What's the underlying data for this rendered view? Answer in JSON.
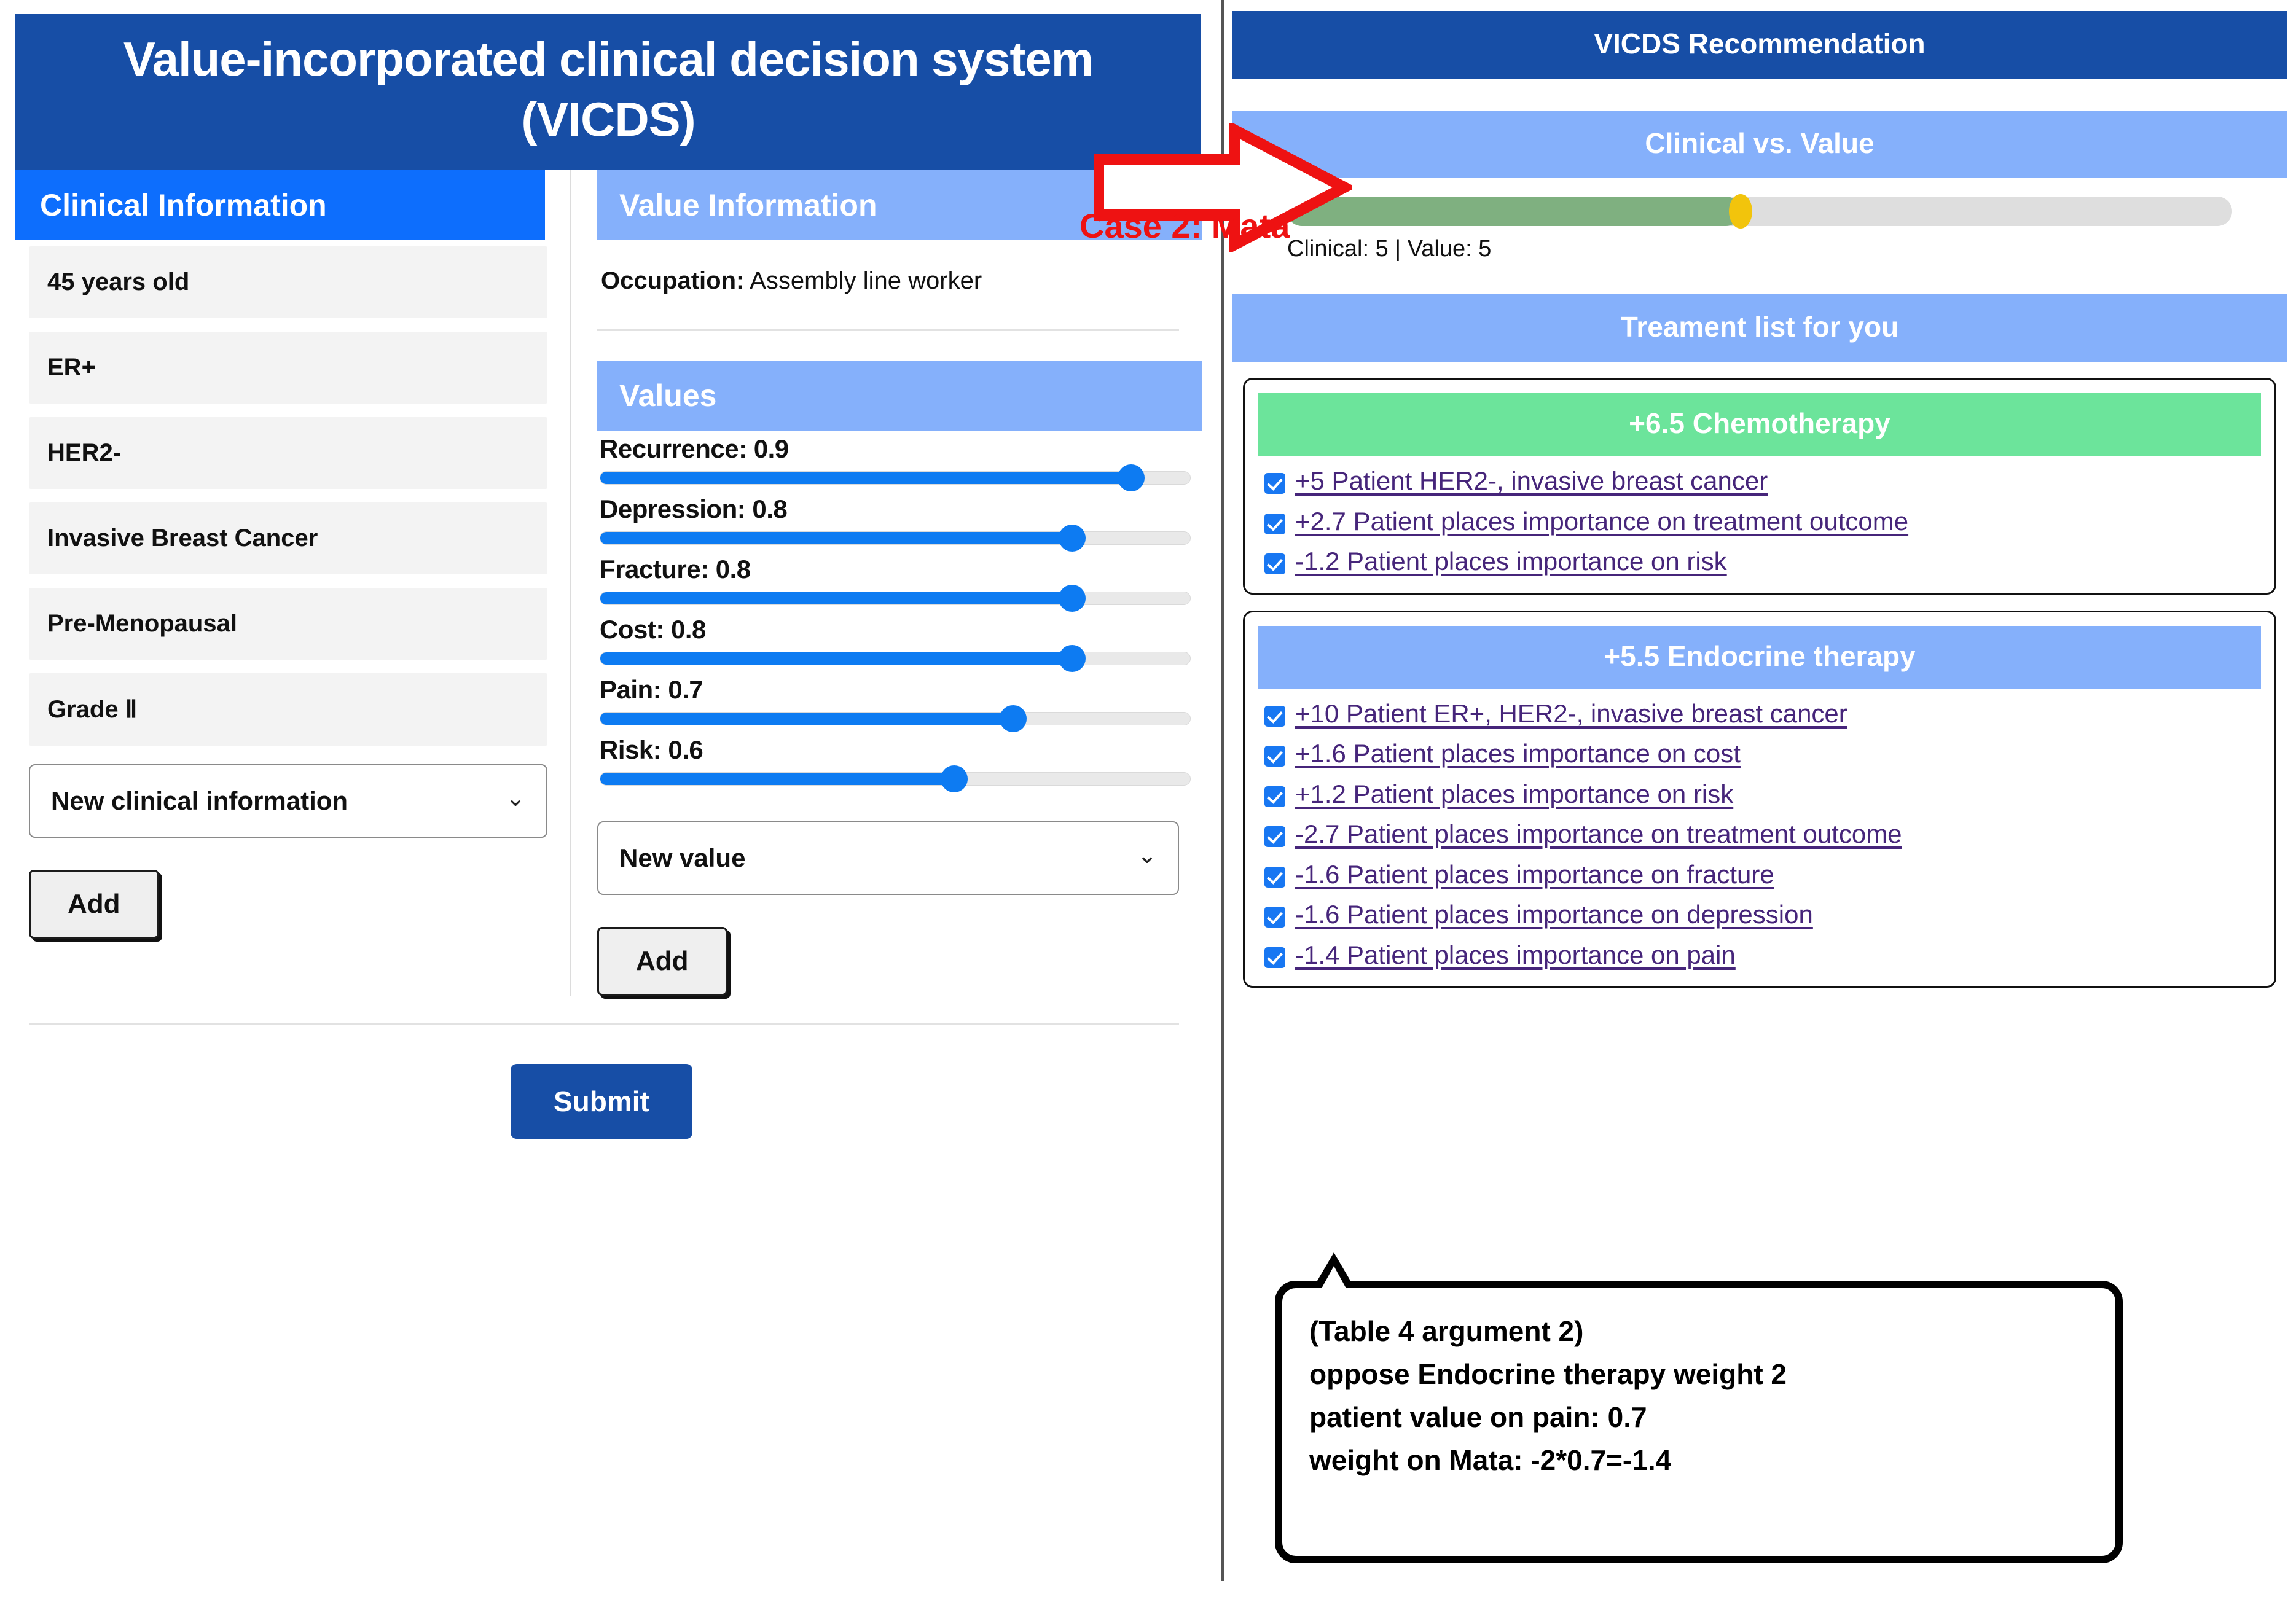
{
  "app": {
    "title": "Value-incorporated clinical decision system (VICDS)"
  },
  "clinical": {
    "section_title": "Clinical Information",
    "items": [
      "45 years old",
      "ER+",
      "HER2-",
      "Invasive Breast Cancer",
      "Pre-Menopausal",
      "Grade Ⅱ"
    ],
    "select_value": "New clinical information",
    "add_label": "Add"
  },
  "value_info": {
    "section_title": "Value Information",
    "occupation_label": "Occupation:",
    "occupation_value": "Assembly line worker",
    "values_title": "Values",
    "sliders": [
      {
        "label": "Recurrence: 0.9",
        "name": "Recurrence",
        "value": 0.9
      },
      {
        "label": "Depression: 0.8",
        "name": "Depression",
        "value": 0.8
      },
      {
        "label": "Fracture: 0.8",
        "name": "Fracture",
        "value": 0.8
      },
      {
        "label": "Cost: 0.8",
        "name": "Cost",
        "value": 0.8
      },
      {
        "label": "Pain: 0.7",
        "name": "Pain",
        "value": 0.7
      },
      {
        "label": "Risk: 0.6",
        "name": "Risk",
        "value": 0.6
      }
    ],
    "select_value": "New value",
    "add_label": "Add"
  },
  "submit_label": "Submit",
  "recommendation": {
    "title": "VICDS Recommendation",
    "compare_title": "Clinical vs. Value",
    "progress_label": "Clinical: 5 | Value: 5",
    "progress_fill_percent": 48,
    "progress_marker_percent": 48,
    "treatment_list_title": "Treament list for you",
    "treatments": [
      {
        "title": "+6.5 Chemotherapy",
        "header_color": "#6ce49b",
        "reasons": [
          "+5 Patient HER2-, invasive breast cancer",
          "+2.7 Patient places importance on treatment outcome",
          "-1.2 Patient places importance on risk"
        ]
      },
      {
        "title": "+5.5 Endocrine therapy",
        "header_color": "#85b0fb",
        "reasons": [
          "+10 Patient ER+, HER2-, invasive breast cancer",
          "+1.6 Patient places importance on cost",
          "+1.2 Patient places importance on risk",
          "-2.7 Patient places importance on treatment outcome",
          "-1.6 Patient places importance on fracture",
          "-1.6 Patient places importance on depression",
          "-1.4 Patient places importance on pain"
        ]
      }
    ]
  },
  "annotations": {
    "case_label": "Case 2: Mata",
    "callout_lines": [
      "(Table 4 argument 2)",
      " oppose Endocrine therapy weight 2",
      "patient value on pain:  0.7",
      "weight on Mata: -2*0.7=-1.4"
    ]
  },
  "colors": {
    "header_blue": "#174ea6",
    "accent_blue": "#0d6efd",
    "light_blue": "#85b0fb",
    "green": "#6ce49b",
    "progress_green": "#7fb080",
    "progress_yellow": "#f2c40c",
    "annotation_red": "#ee1212",
    "link_purple": "#46257a"
  }
}
